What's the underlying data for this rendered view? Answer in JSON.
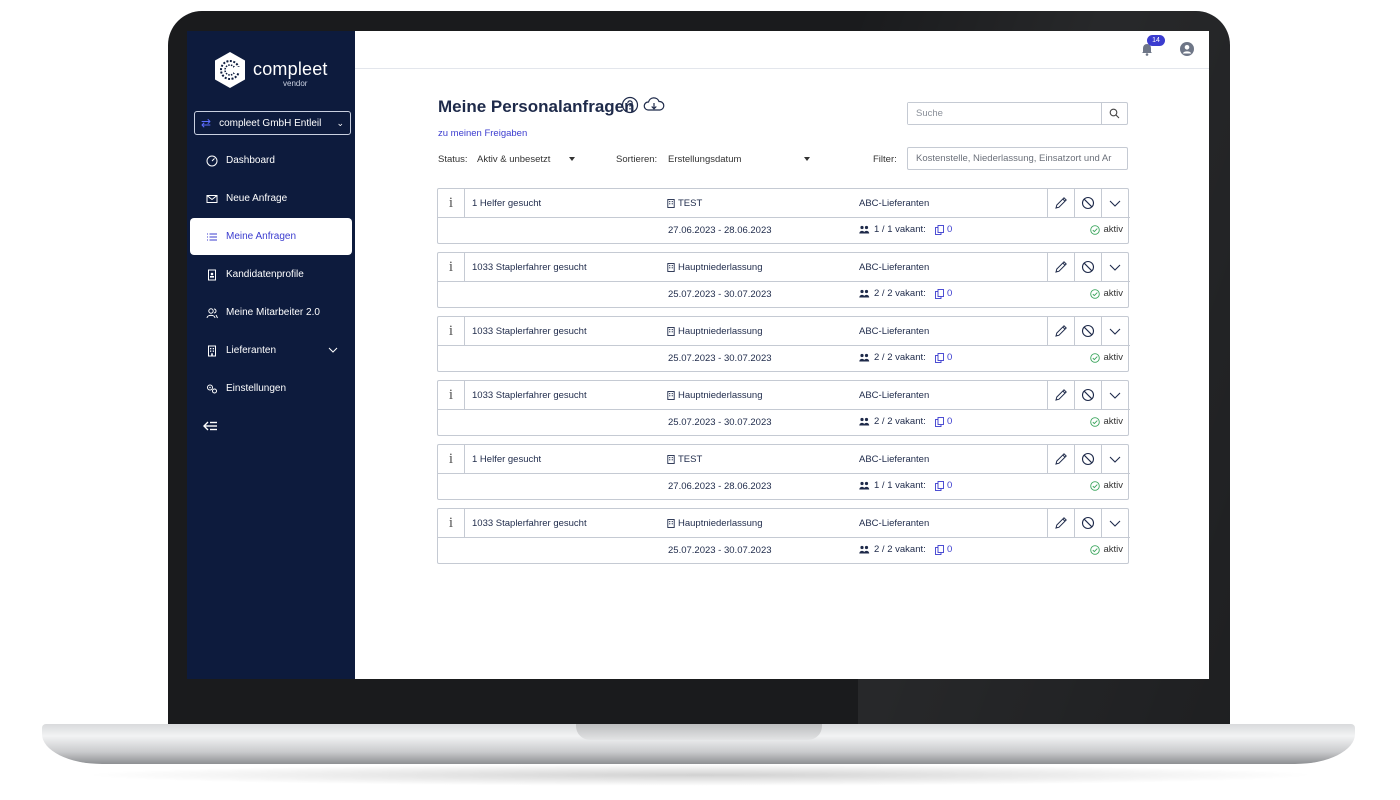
{
  "brand": {
    "name": "compleet",
    "sub": "vendor",
    "accent": "#3b3ccf",
    "sidebar_bg": "#0d1b3d"
  },
  "company_selector": {
    "value": "compleet GmbH Entleil"
  },
  "sidebar": {
    "items": [
      {
        "label": "Dashboard",
        "icon": "gauge-icon",
        "active": false
      },
      {
        "label": "Neue Anfrage",
        "icon": "envelope-icon",
        "active": false
      },
      {
        "label": "Meine Anfragen",
        "icon": "list-icon",
        "active": true
      },
      {
        "label": "Kandidatenprofile",
        "icon": "profile-document-icon",
        "active": false
      },
      {
        "label": "Meine Mitarbeiter 2.0",
        "icon": "users-icon",
        "active": false
      },
      {
        "label": "Lieferanten",
        "icon": "building-icon",
        "active": false,
        "has_submenu": true
      },
      {
        "label": "Einstellungen",
        "icon": "gears-icon",
        "active": false
      }
    ],
    "collapse_icon": "collapse-left-icon"
  },
  "topbar": {
    "notification_count": "14",
    "notification_icon": "bell-icon",
    "user_icon": "user-circle-icon"
  },
  "page": {
    "title": "Meine Personalanfragen",
    "sublink": "zu meinen Freigaben",
    "search_placeholder": "Suche",
    "status_label": "Status:",
    "status_value": "Aktiv & unbesetzt",
    "sort_label": "Sortieren:",
    "sort_value": "Erstellungsdatum",
    "filter_label": "Filter:",
    "filter_placeholder": "Kostenstelle, Niederlassung, Einsatzort und Ar"
  },
  "requests": [
    {
      "title": "1 Helfer gesucht",
      "location": "TEST",
      "supplier": "ABC-Lieferanten",
      "dates": "27.06.2023 - 28.06.2023",
      "heads": "1 / 1 vakant:",
      "copies": "0",
      "status": "aktiv"
    },
    {
      "title": "1033 Staplerfahrer gesucht",
      "location": "Hauptniederlassung",
      "supplier": "ABC-Lieferanten",
      "dates": "25.07.2023 - 30.07.2023",
      "heads": "2 / 2 vakant:",
      "copies": "0",
      "status": "aktiv"
    },
    {
      "title": "1033 Staplerfahrer gesucht",
      "location": "Hauptniederlassung",
      "supplier": "ABC-Lieferanten",
      "dates": "25.07.2023 - 30.07.2023",
      "heads": "2 / 2 vakant:",
      "copies": "0",
      "status": "aktiv"
    },
    {
      "title": "1033 Staplerfahrer gesucht",
      "location": "Hauptniederlassung",
      "supplier": "ABC-Lieferanten",
      "dates": "25.07.2023 - 30.07.2023",
      "heads": "2 / 2 vakant:",
      "copies": "0",
      "status": "aktiv"
    },
    {
      "title": "1 Helfer gesucht",
      "location": "TEST",
      "supplier": "ABC-Lieferanten",
      "dates": "27.06.2023 - 28.06.2023",
      "heads": "1 / 1 vakant:",
      "copies": "0",
      "status": "aktiv"
    },
    {
      "title": "1033 Staplerfahrer gesucht",
      "location": "Hauptniederlassung",
      "supplier": "ABC-Lieferanten",
      "dates": "25.07.2023 - 30.07.2023",
      "heads": "2 / 2 vakant:",
      "copies": "0",
      "status": "aktiv"
    }
  ],
  "status_color": "#3aa55c"
}
